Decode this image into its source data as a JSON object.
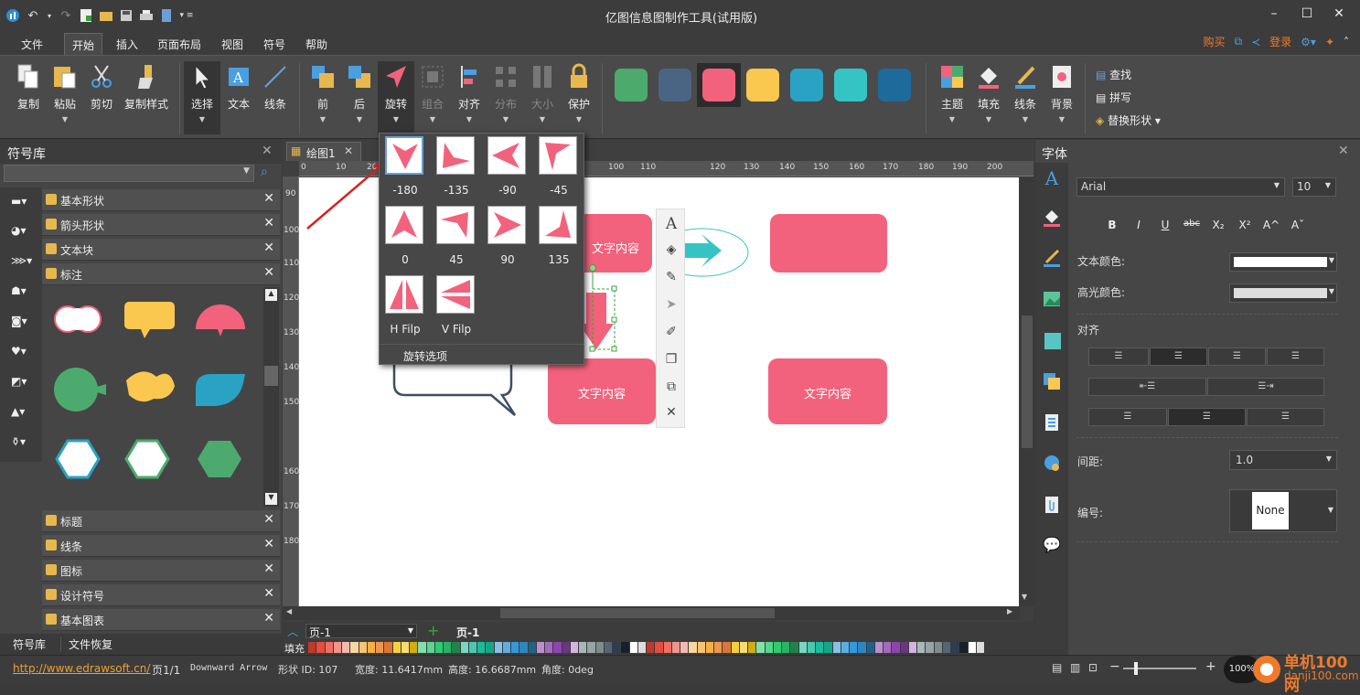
{
  "app": {
    "title": "亿图信息图制作工具(试用版)"
  },
  "menu": {
    "items": [
      "文件",
      "开始",
      "插入",
      "页面布局",
      "视图",
      "符号",
      "帮助"
    ],
    "active": "开始",
    "buy": "购买",
    "login": "登录"
  },
  "ribbon": {
    "copy": "复制",
    "paste": "粘贴",
    "cut": "剪切",
    "format_painter": "复制样式",
    "select": "选择",
    "text": "文本",
    "line": "线条",
    "front": "前",
    "back": "后",
    "rotate": "旋转",
    "group": "组合",
    "align": "对齐",
    "distribute": "分布",
    "size": "大小",
    "protect": "保护",
    "theme": "主题",
    "fill": "填充",
    "line_style": "线条",
    "background": "背景",
    "find": "查找",
    "spell": "拼写",
    "replace_shape": "替换形状",
    "swatches": [
      "#4caa6e",
      "#4a6484",
      "#f2627c",
      "#fac84f",
      "#2aa2c4",
      "#35c4c4",
      "#1e6a9a"
    ]
  },
  "left_panel": {
    "title": "符号库",
    "libraries_top": [
      "基本形状",
      "箭头形状",
      "文本块",
      "标注"
    ],
    "libraries_bottom": [
      "标题",
      "线条",
      "图标",
      "设计符号",
      "基本图表"
    ],
    "tabs": [
      "符号库",
      "文件恢复"
    ]
  },
  "document": {
    "tab_label": "绘图1",
    "shape_text_1": "文字内容",
    "shape_text_2": "文字内容",
    "shape_text_3": "文字内容",
    "ruler_h": [
      "0",
      "10",
      "20",
      "100",
      "110",
      "120",
      "130",
      "140",
      "150",
      "160",
      "170",
      "180",
      "190",
      "200"
    ],
    "ruler_v": [
      "90",
      "100",
      "110",
      "120",
      "130",
      "140",
      "150",
      "160",
      "170",
      "180"
    ]
  },
  "rotate_menu": {
    "options": [
      "-180",
      "-135",
      "-90",
      "-45",
      "0",
      "45",
      "90",
      "135",
      "H Filp",
      "V Filp"
    ],
    "footer": "旋转选项"
  },
  "page_bar": {
    "page_select": "页-1",
    "page_tab": "页-1",
    "fill_label": "填充"
  },
  "right_panel": {
    "title": "字体",
    "font": "Arial",
    "font_size": "10",
    "format_buttons": [
      "B",
      "I",
      "U",
      "abc",
      "X₂",
      "X²",
      "A^",
      "Aˇ"
    ],
    "text_color_label": "文本颜色:",
    "highlight_label": "高光颜色:",
    "align_label": "对齐",
    "spacing_label": "间距:",
    "spacing_value": "1.0",
    "numbering_label": "编号:",
    "numbering_value": "None"
  },
  "status": {
    "url": "http://www.edrawsoft.cn/",
    "page": "页1/1",
    "shape_name": "Downward Arrow",
    "shape_id": "形状 ID: 107",
    "width": "宽度: 11.6417mm",
    "height": "高度: 16.6687mm",
    "angle": "角度: 0deg",
    "zoom": "100%",
    "watermark": "单机100网",
    "watermark_url": "danji100.com"
  }
}
